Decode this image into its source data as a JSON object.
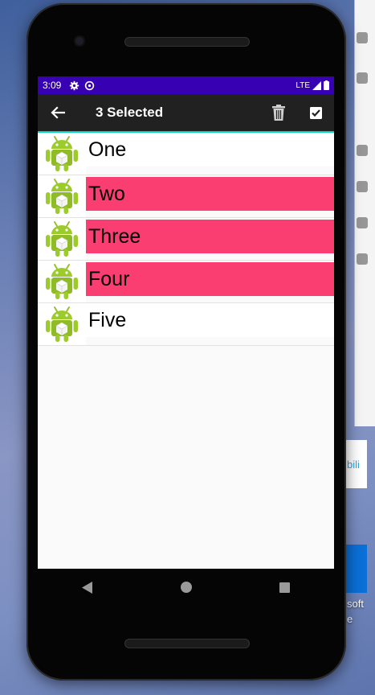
{
  "status_bar": {
    "time": "3:09",
    "network": "LTE"
  },
  "toolbar": {
    "title": "3 Selected",
    "back_icon": "arrow-left-icon",
    "delete_icon": "trash-icon",
    "select_all_icon": "checkbox-checked-icon"
  },
  "list": {
    "items": [
      {
        "label": "One",
        "selected": false
      },
      {
        "label": "Two",
        "selected": true
      },
      {
        "label": "Three",
        "selected": true
      },
      {
        "label": "Four",
        "selected": true
      },
      {
        "label": "Five",
        "selected": false
      }
    ]
  },
  "colors": {
    "status_bar": "#3700b3",
    "toolbar": "#212121",
    "accent_line": "#03dac5",
    "selected": "#fa3e72"
  },
  "desktop": {
    "labels": [
      "bili",
      "soft",
      "e"
    ]
  }
}
